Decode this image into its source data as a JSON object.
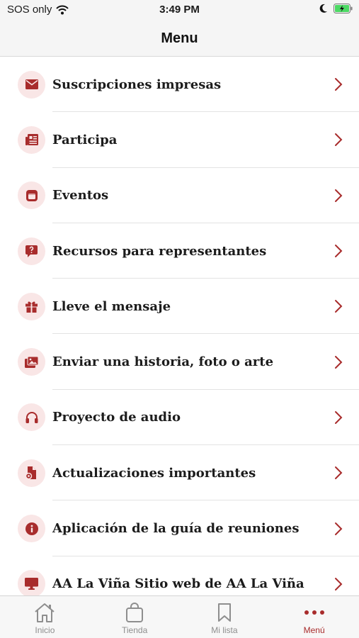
{
  "status_bar": {
    "carrier": "SOS only",
    "time": "3:49 PM"
  },
  "header": {
    "title": "Menu"
  },
  "colors": {
    "accent": "#a82c2c",
    "icon_bg": "#f9e6e6"
  },
  "menu": {
    "items": [
      {
        "label": "Suscripciones impresas",
        "icon": "envelope-icon"
      },
      {
        "label": "Participa",
        "icon": "newspaper-icon"
      },
      {
        "label": "Eventos",
        "icon": "calendar-icon"
      },
      {
        "label": "Recursos para representantes",
        "icon": "question-bubble-icon"
      },
      {
        "label": "Lleve el mensaje",
        "icon": "gift-icon"
      },
      {
        "label": "Enviar una historia, foto o arte",
        "icon": "images-icon"
      },
      {
        "label": "Proyecto de audio",
        "icon": "headphones-icon"
      },
      {
        "label": "Actualizaciones importantes",
        "icon": "file-gear-icon"
      },
      {
        "label": "Aplicación de la guía de reuniones",
        "icon": "info-icon"
      },
      {
        "label": "AA La Viña Sitio web de AA La Viña",
        "icon": "monitor-icon"
      }
    ]
  },
  "tab_bar": {
    "tabs": [
      {
        "label": "Inicio",
        "icon": "home-icon"
      },
      {
        "label": "Tienda",
        "icon": "bag-icon"
      },
      {
        "label": "Mi lista",
        "icon": "bookmark-icon"
      },
      {
        "label": "Menú",
        "icon": "more-dots-icon",
        "active": true
      }
    ]
  }
}
